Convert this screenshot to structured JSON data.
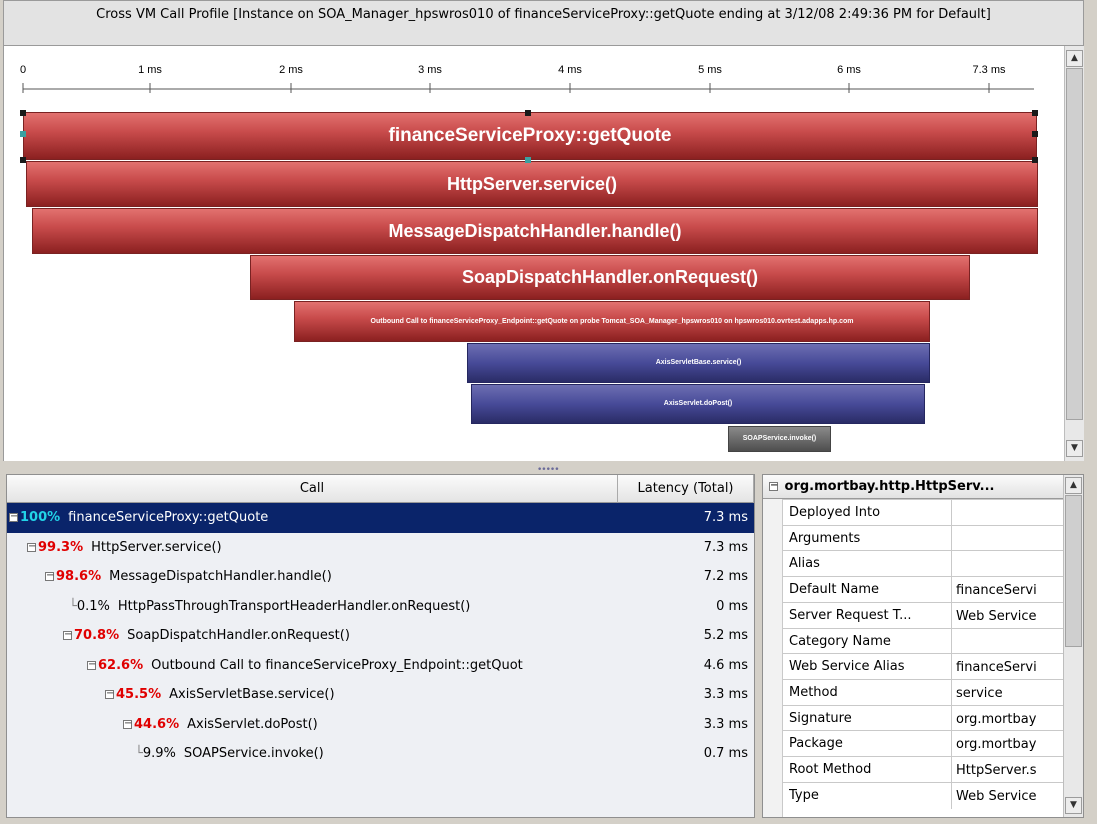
{
  "title": "Cross VM Call Profile [Instance on SOA_Manager_hpswros010 of financeServiceProxy::getQuote ending at 3/12/08 2:49:36 PM for Default]",
  "axis": {
    "ticks": [
      "0",
      "1 ms",
      "2 ms",
      "3 ms",
      "4 ms",
      "5 ms",
      "6 ms",
      "7.3 ms"
    ]
  },
  "profile_bars": [
    {
      "label": "financeServiceProxy::getQuote"
    },
    {
      "label": "HttpServer.service()"
    },
    {
      "label": "MessageDispatchHandler.handle()"
    },
    {
      "label": "SoapDispatchHandler.onRequest()"
    },
    {
      "label": "Outbound Call to financeServiceProxy_Endpoint::getQuote on probe Tomcat_SOA_Manager_hpswros010 on hpswros010.ovrtest.adapps.hp.com"
    },
    {
      "label": "AxisServletBase.service()"
    },
    {
      "label": "AxisServlet.doPost()"
    },
    {
      "label": "SOAPService.invoke()"
    }
  ],
  "tree": {
    "col_call": "Call",
    "col_latency": "Latency (Total)",
    "rows": [
      {
        "pct": "100%",
        "name": "financeServiceProxy::getQuote",
        "latency": "7.3 ms"
      },
      {
        "pct": "99.3%",
        "name": "HttpServer.service()",
        "latency": "7.3 ms"
      },
      {
        "pct": "98.6%",
        "name": "MessageDispatchHandler.handle()",
        "latency": "7.2 ms"
      },
      {
        "pct": "0.1%",
        "name": "HttpPassThroughTransportHeaderHandler.onRequest()",
        "latency": "0 ms"
      },
      {
        "pct": "70.8%",
        "name": "SoapDispatchHandler.onRequest()",
        "latency": "5.2 ms"
      },
      {
        "pct": "62.6%",
        "name": "Outbound Call to financeServiceProxy_Endpoint::getQuot",
        "latency": "4.6 ms"
      },
      {
        "pct": "45.5%",
        "name": "AxisServletBase.service()",
        "latency": "3.3 ms"
      },
      {
        "pct": "44.6%",
        "name": "AxisServlet.doPost()",
        "latency": "3.3 ms"
      },
      {
        "pct": "9.9%",
        "name": "SOAPService.invoke()",
        "latency": "0.7 ms"
      }
    ]
  },
  "props": {
    "header": "org.mortbay.http.HttpServ...",
    "header_toggle": "−",
    "rows": [
      {
        "key": "Deployed Into",
        "value": ""
      },
      {
        "key": "Arguments",
        "value": ""
      },
      {
        "key": "Alias",
        "value": ""
      },
      {
        "key": "Default Name",
        "value": "financeServi"
      },
      {
        "key": "Server Request T...",
        "value": "Web Service"
      },
      {
        "key": "Category Name",
        "value": ""
      },
      {
        "key": "Web Service Alias",
        "value": "financeServi"
      },
      {
        "key": "Method",
        "value": "service"
      },
      {
        "key": "Signature",
        "value": "org.mortbay"
      },
      {
        "key": "Package",
        "value": "org.mortbay"
      },
      {
        "key": "Root Method",
        "value": "HttpServer.s"
      },
      {
        "key": "Type",
        "value": "Web Service"
      }
    ]
  },
  "scroll_icons": {
    "up": "▲",
    "down": "▼"
  }
}
